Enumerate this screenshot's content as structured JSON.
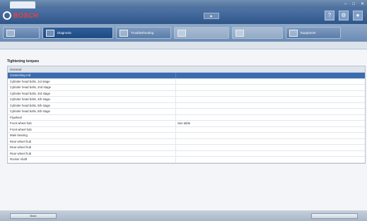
{
  "window": {
    "title": ""
  },
  "header": {
    "brand": "BOSCH",
    "vehicle_info": "",
    "vin_label": ""
  },
  "nav": {
    "tabs": [
      {
        "label": ""
      },
      {
        "label": "Diagnosis"
      },
      {
        "label": "Troubleshooting"
      },
      {
        "label": ""
      },
      {
        "label": ""
      },
      {
        "label": "Equipment"
      }
    ]
  },
  "breadcrumb": "",
  "section_title": "Tightening torques",
  "group_label": "General",
  "rows": [
    {
      "component": "Connecting rod",
      "value": "",
      "selected": true
    },
    {
      "component": "Cylinder head bolts, 1st stage",
      "value": ""
    },
    {
      "component": "Cylinder head bolts, 2nd stage",
      "value": ""
    },
    {
      "component": "Cylinder head bolts, 3rd stage",
      "value": ""
    },
    {
      "component": "Cylinder head bolts, 4th stage",
      "value": ""
    },
    {
      "component": "Cylinder head bolts, 5th stage",
      "value": ""
    },
    {
      "component": "Cylinder head bolts, 6th stage",
      "value": ""
    },
    {
      "component": "Flywheel",
      "value": ""
    },
    {
      "component": "Front wheel hub",
      "value": "See table"
    },
    {
      "component": "Front wheel hub",
      "value": ""
    },
    {
      "component": "Main bearing",
      "value": ""
    },
    {
      "component": "Rear wheel hub",
      "value": ""
    },
    {
      "component": "Rear wheel hub",
      "value": ""
    },
    {
      "component": "Rear wheel hub",
      "value": ""
    },
    {
      "component": "Rocker shaft",
      "value": ""
    }
  ],
  "footer": {
    "back_label": "Back",
    "next_label": ""
  },
  "colors": {
    "header": "#2f5689",
    "selected_row": "#3a6cb0",
    "brand_red": "#ff3b3b"
  }
}
